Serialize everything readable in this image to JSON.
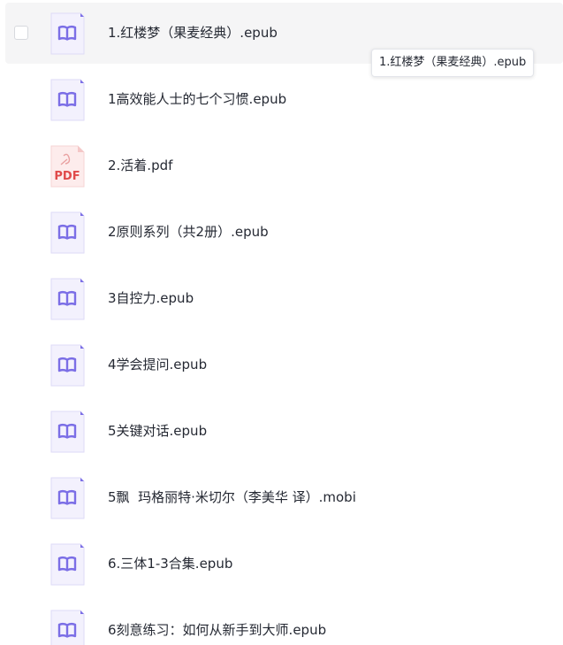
{
  "files": [
    {
      "name": "1.红楼梦（果麦经典）.epub",
      "icon": "epub-book-icon"
    },
    {
      "name": "1高效能人士的七个习惯.epub",
      "icon": "epub-book-icon"
    },
    {
      "name": "2.活着.pdf",
      "icon": "pdf-file-icon",
      "icon_text": "PDF"
    },
    {
      "name": "2原则系列（共2册）.epub",
      "icon": "epub-book-icon"
    },
    {
      "name": "3自控力.epub",
      "icon": "epub-book-icon"
    },
    {
      "name": "4学会提问.epub",
      "icon": "epub-book-icon"
    },
    {
      "name": "5关键对话.epub",
      "icon": "epub-book-icon"
    },
    {
      "name": "5飘  玛格丽特·米切尔（李美华 译）.mobi",
      "icon": "epub-book-icon"
    },
    {
      "name": "6.三体1-3合集.epub",
      "icon": "epub-book-icon"
    },
    {
      "name": "6刻意练习：如何从新手到大师.epub",
      "icon": "epub-book-icon"
    }
  ],
  "tooltip": {
    "text": "1.红楼梦（果麦经典）.epub"
  },
  "colors": {
    "hover_row": "#f5f5f6",
    "ebook_icon_bg": "#f3f1fd",
    "ebook_icon_accent": "#7b6ee6",
    "pdf_icon_bg": "#fdecec",
    "pdf_icon_accent": "#e04a4a",
    "text": "#252933"
  }
}
